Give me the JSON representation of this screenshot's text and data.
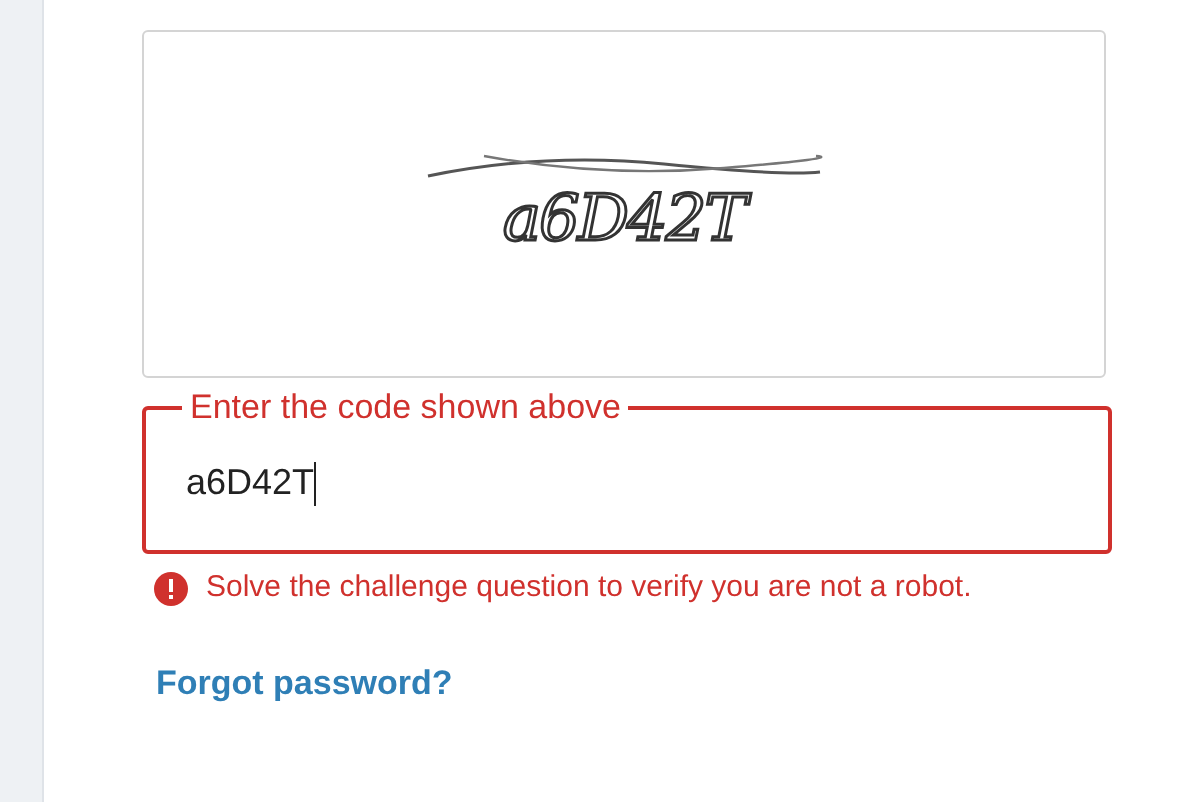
{
  "captcha": {
    "code": "a6D42T"
  },
  "code_field": {
    "label": "Enter the code shown above",
    "value": "a6D42T",
    "invalid": true
  },
  "error": {
    "message": "Solve the challenge question to verify you are not a robot."
  },
  "forgot_link": "Forgot password?"
}
